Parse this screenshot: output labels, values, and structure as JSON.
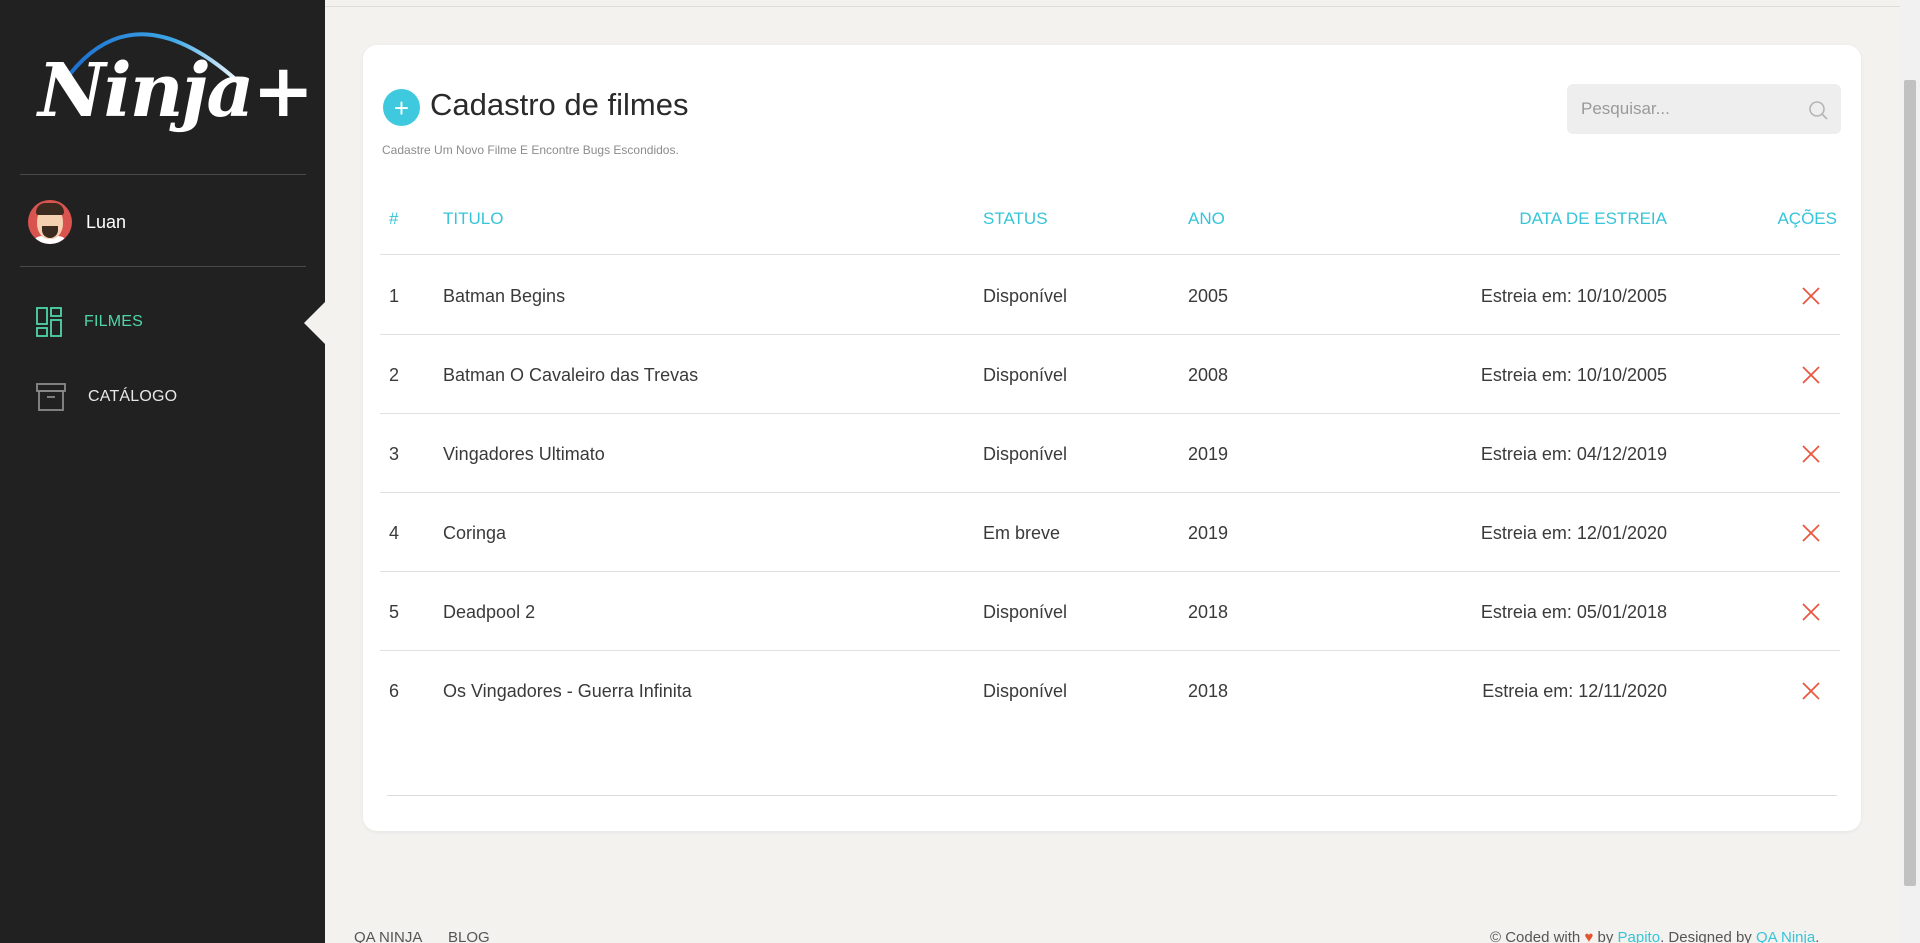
{
  "brand": {
    "logo_text": "Ninja+"
  },
  "user": {
    "name": "Luan"
  },
  "sidebar": {
    "items": [
      {
        "label": "FILMES",
        "icon": "dashboard-icon",
        "active": true
      },
      {
        "label": "CATÁLOGO",
        "icon": "archive-box-icon",
        "active": false
      }
    ]
  },
  "main": {
    "title": "Cadastro de filmes",
    "subtitle": "Cadastre Um Novo Filme E Encontre Bugs Escondidos.",
    "add_button_label": "+",
    "search": {
      "placeholder": "Pesquisar...",
      "value": ""
    },
    "table": {
      "columns": [
        "#",
        "TITULO",
        "STATUS",
        "ANO",
        "DATA DE ESTREIA",
        "AÇÕES"
      ],
      "rows": [
        {
          "id": "1",
          "title": "Batman Begins",
          "status": "Disponível",
          "year": "2005",
          "release": "Estreia em: 10/10/2005"
        },
        {
          "id": "2",
          "title": "Batman O Cavaleiro das Trevas",
          "status": "Disponível",
          "year": "2008",
          "release": "Estreia em: 10/10/2005"
        },
        {
          "id": "3",
          "title": "Vingadores Ultimato",
          "status": "Disponível",
          "year": "2019",
          "release": "Estreia em: 04/12/2019"
        },
        {
          "id": "4",
          "title": "Coringa",
          "status": "Em breve",
          "year": "2019",
          "release": "Estreia em: 12/01/2020"
        },
        {
          "id": "5",
          "title": "Deadpool 2",
          "status": "Disponível",
          "year": "2018",
          "release": "Estreia em: 05/01/2018"
        },
        {
          "id": "6",
          "title": "Os Vingadores - Guerra Infinita",
          "status": "Disponível",
          "year": "2018",
          "release": "Estreia em: 12/11/2020"
        }
      ]
    }
  },
  "footer": {
    "links": [
      "QA NINJA",
      "BLOG"
    ],
    "credit_prefix": "© Coded with",
    "credit_by": "by",
    "credit_author": "Papito",
    "credit_designed": ". Designed by",
    "credit_designer": "QA Ninja",
    "credit_suffix": "."
  },
  "colors": {
    "sidebar_bg": "#212121",
    "accent": "#36c4d9",
    "active_nav": "#4fd6a7",
    "delete": "#e9573f",
    "page_bg": "#f3f2ef"
  }
}
